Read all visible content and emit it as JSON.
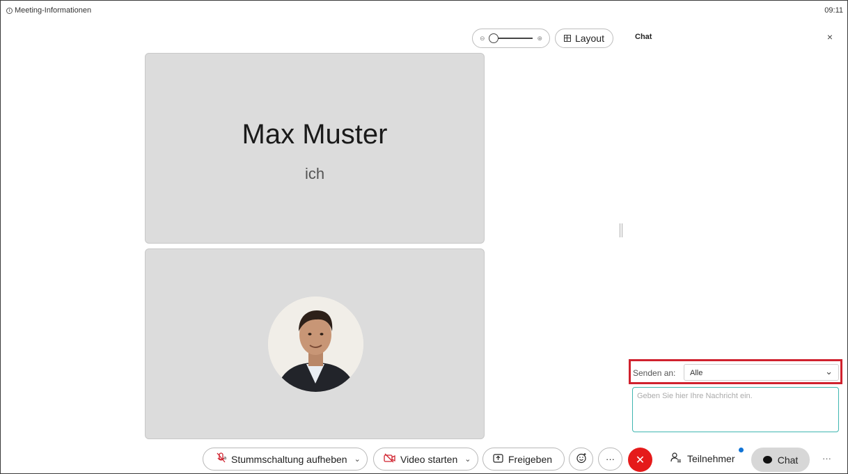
{
  "topbar": {
    "info_label": "Meeting-Informationen",
    "clock": "09:11"
  },
  "video_toolbar": {
    "layout_label": "Layout"
  },
  "tiles": [
    {
      "name": "Max Muster",
      "subtitle": "ich"
    },
    {
      "avatar": "profile-photo"
    }
  ],
  "chat_panel": {
    "title": "Chat",
    "close_glyph": "×",
    "send_to_label": "Senden an:",
    "send_to_value": "Alle",
    "message_placeholder": "Geben Sie hier Ihre Nachricht ein."
  },
  "controls": {
    "mute_label": "Stummschaltung aufheben",
    "video_label": "Video starten",
    "share_label": "Freigeben",
    "more_glyph": "···",
    "end_glyph": "✕",
    "participants_label": "Teilnehmer",
    "chat_label": "Chat",
    "overflow_glyph": "···"
  },
  "colors": {
    "highlight": "#d0222e",
    "end_call": "#e51a1a",
    "notification": "#1174d6",
    "input_focus": "#3fb6b0"
  }
}
